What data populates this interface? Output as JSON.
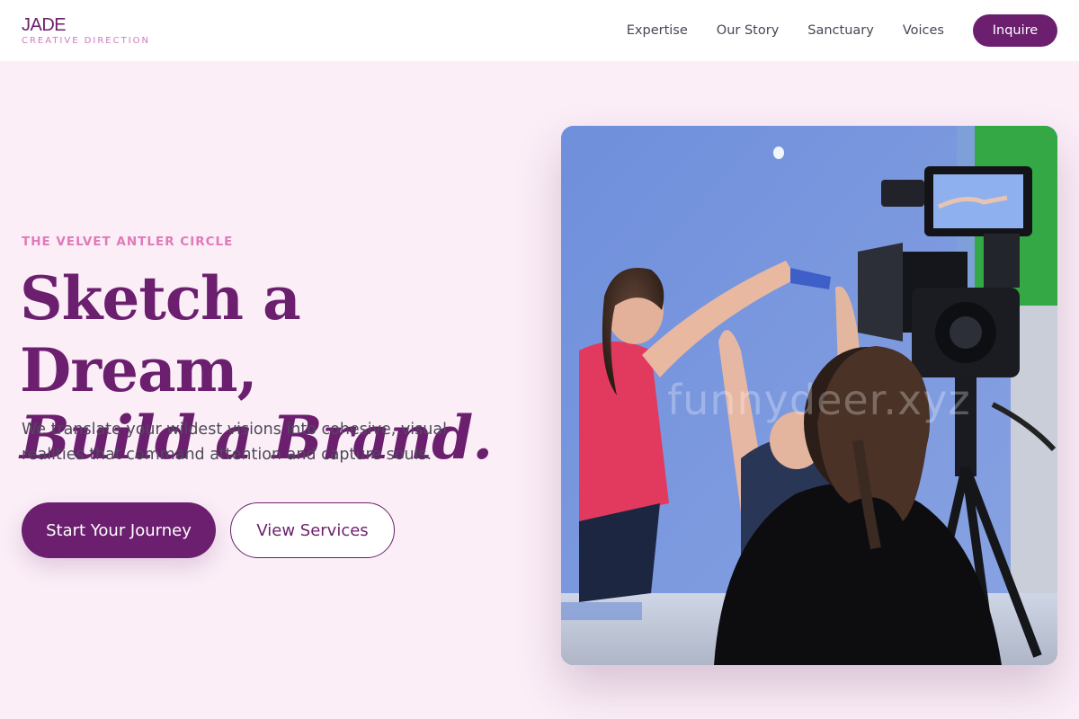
{
  "header": {
    "brand_name": "JADE",
    "brand_tagline": "CREATIVE DIRECTION",
    "nav": [
      {
        "label": "Expertise"
      },
      {
        "label": "Our Story"
      },
      {
        "label": "Sanctuary"
      },
      {
        "label": "Voices"
      }
    ],
    "cta_label": "Inquire"
  },
  "hero": {
    "eyebrow": "THE VELVET ANTLER CIRCLE",
    "headline_line1": "Sketch a Dream,",
    "headline_line2": "Build a Brand.",
    "lede": "We translate your wildest visions into cohesive, visual realities that command attention and capture souls.",
    "primary_button": "Start Your Journey",
    "secondary_button": "View Services",
    "image_watermark": "funnydeer.xyz"
  },
  "colors": {
    "accent": "#6b1f6e",
    "eyebrow": "#e07ab8",
    "background": "#fbeef7",
    "header_background": "#ffffff"
  }
}
